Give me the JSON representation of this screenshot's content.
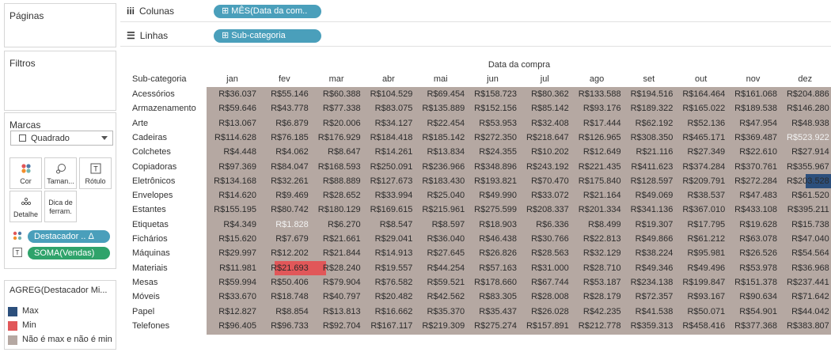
{
  "left_panel": {
    "pages_title": "Páginas",
    "filters_title": "Filtros",
    "marks": {
      "title": "Marcas",
      "mark_type": "Quadrado",
      "buttons": [
        {
          "label": "Cor",
          "icon": "color-dots-icon"
        },
        {
          "label": "Taman...",
          "icon": "size-icon"
        },
        {
          "label": "Rótulo",
          "icon": "label-icon"
        },
        {
          "label": "Detalhe",
          "icon": "detail-dots-icon"
        },
        {
          "label": "Dica de ferram.",
          "icon": "tooltip-icon"
        }
      ],
      "pills": [
        {
          "label": "Destacador .. Δ",
          "icon": "color-dots-icon"
        },
        {
          "label": "SOMA(Vendas)",
          "icon": "text-T-icon"
        }
      ]
    },
    "legend": {
      "title": "AGREG(Destacador Mi...",
      "items": [
        {
          "label": "Max",
          "color": "#2c4f7c"
        },
        {
          "label": "Min",
          "color": "#e15759"
        },
        {
          "label": "Não é max e não é min",
          "color": "#b5a8a2"
        }
      ]
    }
  },
  "shelves": {
    "columns_label": "Colunas",
    "columns_pill": "MÊS(Data da com..",
    "rows_label": "Linhas",
    "rows_pill": "Sub-categoria"
  },
  "table": {
    "column_title": "Data da compra",
    "row_header": "Sub-categoria",
    "months": [
      "jan",
      "fev",
      "mar",
      "abr",
      "mai",
      "jun",
      "jul",
      "ago",
      "set",
      "out",
      "nov",
      "dez"
    ],
    "rows": [
      {
        "name": "Acessórios",
        "values": [
          "R$36.037",
          "R$55.146",
          "R$60.388",
          "R$104.529",
          "R$69.454",
          "R$158.723",
          "R$80.362",
          "R$133.588",
          "R$194.516",
          "R$164.464",
          "R$161.068",
          "R$204.886"
        ]
      },
      {
        "name": "Armazenamento",
        "values": [
          "R$59.646",
          "R$43.778",
          "R$77.338",
          "R$83.075",
          "R$135.889",
          "R$152.156",
          "R$85.142",
          "R$93.176",
          "R$189.322",
          "R$165.022",
          "R$189.538",
          "R$146.280"
        ]
      },
      {
        "name": "Arte",
        "values": [
          "R$13.067",
          "R$6.879",
          "R$20.006",
          "R$34.127",
          "R$22.454",
          "R$53.953",
          "R$32.408",
          "R$17.444",
          "R$62.192",
          "R$52.136",
          "R$47.954",
          "R$48.938"
        ]
      },
      {
        "name": "Cadeiras",
        "values": [
          "R$114.628",
          "R$76.185",
          "R$176.929",
          "R$184.418",
          "R$185.142",
          "R$272.350",
          "R$218.647",
          "R$126.965",
          "R$308.350",
          "R$465.171",
          "R$369.487",
          "R$523.922"
        ]
      },
      {
        "name": "Colchetes",
        "values": [
          "R$4.448",
          "R$4.062",
          "R$8.647",
          "R$14.261",
          "R$13.834",
          "R$24.355",
          "R$10.202",
          "R$12.649",
          "R$21.116",
          "R$27.349",
          "R$22.610",
          "R$27.914"
        ]
      },
      {
        "name": "Copiadoras",
        "values": [
          "R$97.369",
          "R$84.047",
          "R$168.593",
          "R$250.091",
          "R$236.966",
          "R$348.896",
          "R$243.192",
          "R$221.435",
          "R$411.623",
          "R$374.284",
          "R$370.761",
          "R$355.967"
        ]
      },
      {
        "name": "Eletrônicos",
        "values": [
          "R$134.168",
          "R$32.261",
          "R$88.889",
          "R$127.673",
          "R$183.430",
          "R$193.821",
          "R$70.470",
          "R$175.840",
          "R$128.597",
          "R$209.791",
          "R$272.284",
          "R$203.528"
        ]
      },
      {
        "name": "Envelopes",
        "values": [
          "R$14.620",
          "R$9.469",
          "R$28.652",
          "R$33.994",
          "R$25.040",
          "R$49.990",
          "R$33.072",
          "R$21.164",
          "R$49.069",
          "R$38.537",
          "R$47.483",
          "R$61.520"
        ]
      },
      {
        "name": "Estantes",
        "values": [
          "R$155.195",
          "R$80.742",
          "R$180.129",
          "R$169.615",
          "R$215.961",
          "R$275.599",
          "R$208.337",
          "R$201.334",
          "R$341.136",
          "R$367.010",
          "R$433.108",
          "R$395.211"
        ]
      },
      {
        "name": "Etiquetas",
        "values": [
          "R$4.349",
          "R$1.828",
          "R$6.270",
          "R$8.547",
          "R$8.597",
          "R$18.903",
          "R$6.336",
          "R$8.499",
          "R$19.307",
          "R$17.795",
          "R$19.628",
          "R$15.738"
        ]
      },
      {
        "name": "Fichários",
        "values": [
          "R$15.620",
          "R$7.679",
          "R$21.661",
          "R$29.041",
          "R$36.040",
          "R$46.438",
          "R$30.766",
          "R$22.813",
          "R$49.866",
          "R$61.212",
          "R$63.078",
          "R$47.040"
        ]
      },
      {
        "name": "Máquinas",
        "values": [
          "R$29.997",
          "R$12.202",
          "R$21.844",
          "R$14.913",
          "R$27.645",
          "R$26.826",
          "R$28.563",
          "R$32.129",
          "R$38.224",
          "R$95.981",
          "R$26.526",
          "R$54.564"
        ]
      },
      {
        "name": "Materiais",
        "values": [
          "R$11.981",
          "R$21.693",
          "R$28.240",
          "R$19.557",
          "R$44.254",
          "R$57.163",
          "R$31.000",
          "R$28.710",
          "R$49.346",
          "R$49.496",
          "R$53.978",
          "R$36.968"
        ]
      },
      {
        "name": "Mesas",
        "values": [
          "R$59.994",
          "R$50.406",
          "R$79.904",
          "R$76.582",
          "R$59.521",
          "R$178.660",
          "R$67.744",
          "R$53.187",
          "R$234.138",
          "R$199.847",
          "R$151.378",
          "R$237.441"
        ]
      },
      {
        "name": "Móveis",
        "values": [
          "R$33.670",
          "R$18.748",
          "R$40.797",
          "R$20.482",
          "R$42.562",
          "R$83.305",
          "R$28.008",
          "R$28.179",
          "R$72.357",
          "R$93.167",
          "R$90.634",
          "R$71.642"
        ]
      },
      {
        "name": "Papel",
        "values": [
          "R$12.827",
          "R$8.854",
          "R$13.813",
          "R$16.662",
          "R$35.370",
          "R$35.437",
          "R$26.028",
          "R$42.235",
          "R$41.538",
          "R$50.071",
          "R$54.901",
          "R$44.042"
        ]
      },
      {
        "name": "Telefones",
        "values": [
          "R$96.405",
          "R$96.733",
          "R$92.704",
          "R$167.117",
          "R$219.309",
          "R$275.274",
          "R$157.891",
          "R$212.778",
          "R$359.313",
          "R$458.416",
          "R$377.368",
          "R$383.807"
        ]
      }
    ],
    "highlights": {
      "max_color": "#2c4f7c",
      "min_color": "#e15759",
      "base_color": "#b5a8a2",
      "white_text_cells": [
        [
          "Cadeiras",
          "dez"
        ],
        [
          "Etiquetas",
          "fev"
        ]
      ]
    }
  }
}
